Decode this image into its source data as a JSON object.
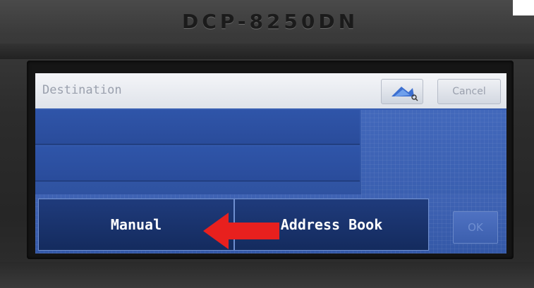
{
  "device": {
    "model": "DCP-8250DN"
  },
  "screen": {
    "destination_placeholder": "Destination",
    "search_icon": "search-address-icon",
    "cancel_label": "Cancel",
    "manual_label": "Manual",
    "address_book_label": "Address Book",
    "ok_label": "OK"
  },
  "annotation": {
    "arrow_color": "#e8201e"
  },
  "colors": {
    "screen_blue": "#3258aa",
    "button_dark": "#1a3470"
  }
}
